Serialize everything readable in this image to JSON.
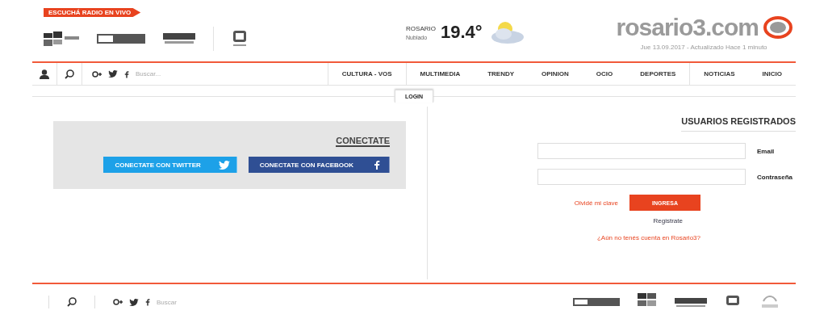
{
  "header": {
    "logo": {
      "name": "rosario3.com",
      "tagline": "Jue 13.09.2017 - Actualizado Hace 1 minuto"
    },
    "weather": {
      "temperature": "19.4°",
      "city": "ROSARIO",
      "condition": "Nublado"
    },
    "live_tag": "ESCUCHÁ RADIO EN VIVO"
  },
  "nav": {
    "items": [
      {
        "label": "CULTURA - VOS",
        "selected": false
      },
      {
        "label": "MULTIMEDIA",
        "selected": false
      },
      {
        "label": "TRENDY",
        "selected": false
      },
      {
        "label": "OPINION",
        "selected": false
      },
      {
        "label": "OCIO",
        "selected": false
      },
      {
        "label": "DEPORTES",
        "selected": false
      },
      {
        "label": "NOTICIAS",
        "selected": false
      },
      {
        "label": "INICIO",
        "selected": false
      }
    ],
    "search_placeholder": "Buscar..."
  },
  "tab": {
    "label": "LOGIN",
    "selected": true
  },
  "login": {
    "title": "USUARIOS REGISTRADOS",
    "fields": [
      {
        "label": "Email"
      },
      {
        "label": "Contraseña"
      }
    ],
    "submit": "INGRESA",
    "forgot": "Olvidé mi clave",
    "register": "Registrate",
    "signup": "¿Aún no tenés cuenta en Rosario3?"
  },
  "connect": {
    "title": "CONECTATE",
    "buttons": [
      {
        "kind": "twitter",
        "label": "CONECTATE CON TWITTER"
      },
      {
        "kind": "facebook",
        "label": "CONECTATE CON FACEBOOK"
      }
    ]
  },
  "footer": {
    "search_placeholder": "Buscar"
  }
}
